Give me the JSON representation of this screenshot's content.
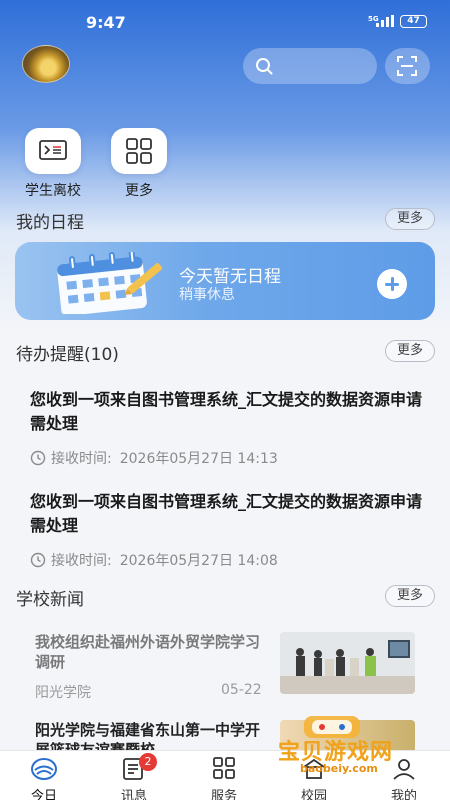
{
  "status_bar": {
    "time": "9:47",
    "signal": "5G",
    "battery": "47"
  },
  "shortcuts": [
    {
      "label": "学生离校",
      "icon": "terminal-icon"
    },
    {
      "label": "更多",
      "icon": "grid-icon"
    }
  ],
  "schedule": {
    "title": "我的日程",
    "more": "更多",
    "empty_main": "今天暂无日程",
    "empty_sub": "稍事休息"
  },
  "todo": {
    "title": "待办提醒(10)",
    "more": "更多",
    "items": [
      {
        "title": "您收到一项来自图书管理系统_汇文提交的数据资源申请需处理",
        "time_label": "接收时间:",
        "time": "2026年05月27日 14:13"
      },
      {
        "title": "您收到一项来自图书管理系统_汇文提交的数据资源申请需处理",
        "time_label": "接收时间:",
        "time": "2026年05月27日 14:08"
      }
    ]
  },
  "news": {
    "title": "学校新闻",
    "more": "更多",
    "items": [
      {
        "title": "我校组织赴福州外语外贸学院学习调研",
        "source": "阳光学院",
        "date": "05-22"
      },
      {
        "title": "阳光学院与福建省东山第一中学开展篮球友谊赛暨校"
      }
    ]
  },
  "tabs": [
    {
      "label": "今日",
      "icon": "home-logo-icon"
    },
    {
      "label": "讯息",
      "icon": "message-icon",
      "badge": "2"
    },
    {
      "label": "服务",
      "icon": "grid-icon"
    },
    {
      "label": "校园",
      "icon": "campus-icon"
    },
    {
      "label": "我的",
      "icon": "profile-icon"
    }
  ],
  "watermark": {
    "text": "宝贝游戏网",
    "url": "baobeiy.com"
  },
  "colors": {
    "accent": "#2f6fd8",
    "badge": "#e53935"
  }
}
